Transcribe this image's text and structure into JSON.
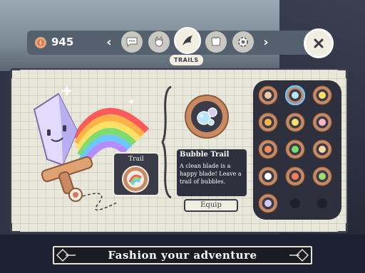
{
  "currency": {
    "icon": "rose-coin-icon",
    "count": "945"
  },
  "tabs": [
    {
      "name": "chat-bubble-icon",
      "active": false
    },
    {
      "name": "pet-icon",
      "active": false
    },
    {
      "name": "trails-icon",
      "active": true
    },
    {
      "name": "armor-icon",
      "active": false
    },
    {
      "name": "gear-icon",
      "active": false
    }
  ],
  "active_tab_label": "TRAILS",
  "trail_slot": {
    "label": "Trail"
  },
  "selected_item": {
    "title": "Bubble Trail",
    "description": "A clean blade is a happy blade! Leave a trail of bubbles.",
    "equip_label": "Equip"
  },
  "grid_items": [
    "feather-trail-icon",
    "bubble-trail-icon",
    "moon-trail-icon",
    "swirl-trail-icon",
    "sun-trail-icon",
    "flower-trail-icon",
    "fire-trail-icon",
    "clover-trail-icon",
    "ribbon-trail-icon",
    "ghost-trail-icon",
    "flame-trail-icon",
    "leaf-trail-icon",
    "beast-trail-icon",
    "empty-slot",
    "empty-slot"
  ],
  "banner": {
    "text": "Fashion your adventure"
  },
  "colors": {
    "copper": "#c98a63",
    "cream": "#f1ede0",
    "dark_panel": "#2e303e",
    "rainbow": [
      "#ff5a5a",
      "#ffb347",
      "#ffe066",
      "#7ddc6b",
      "#6ec6ff",
      "#b58cff"
    ]
  }
}
